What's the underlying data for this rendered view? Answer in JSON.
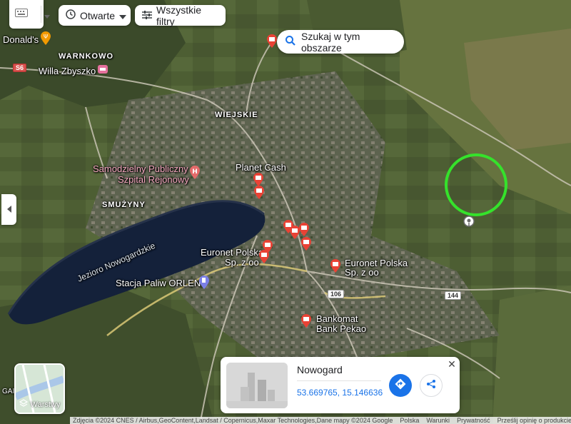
{
  "top_bar": {
    "open_now_label": "Otwarte",
    "all_filters_label": "Wszystkie filtry",
    "search_area_label": "Szukaj w tym obszarze"
  },
  "map": {
    "labels": {
      "mcdonalds": "Donald's",
      "warnkowo": "WARNKOWO",
      "willa": "Willa Zbyszko",
      "wiejskie": "WIEJSKIE",
      "planet_cash": "Planet Cash",
      "hospital_l1": "Samodzielny Publiczny",
      "hospital_l2": "Szpital Rejonowy",
      "smuzyny": "SMUŻYNY",
      "lake": "Jezioro Nowogardzkie",
      "euronet1_l1": "Euronet Polska",
      "euronet1_l2": "Sp. z oo",
      "euronet2_l1": "Euronet Polska",
      "euronet2_l2": "Sp. z oo",
      "orlen": "Stacja Paliw ORLEN",
      "pekao_l1": "Bankomat",
      "pekao_l2": "Bank Pekao",
      "gai": "GAI"
    },
    "road_shields": {
      "s6": "S6",
      "r106": "106",
      "r144": "144"
    },
    "colors": {
      "atm_pin": "#e94235",
      "highlight_circle": "#35e22b",
      "hospital_pin": "#e46a6a",
      "fuel_pin": "#7b7fe6",
      "food_pin": "#f29900"
    }
  },
  "layers_button": {
    "label": "Warstwy"
  },
  "info_card": {
    "title": "Nowogard",
    "coordinates": "53.669765, 15.146636"
  },
  "attribution": {
    "imagery": "Zdjęcia ©2024 CNES / Airbus,GeoContent,Landsat / Copernicus,Maxar Technologies,Dane mapy ©2024 Google",
    "region": "Polska",
    "terms": "Warunki",
    "privacy": "Prywatność",
    "feedback": "Prześlij opinię o produkcie"
  }
}
